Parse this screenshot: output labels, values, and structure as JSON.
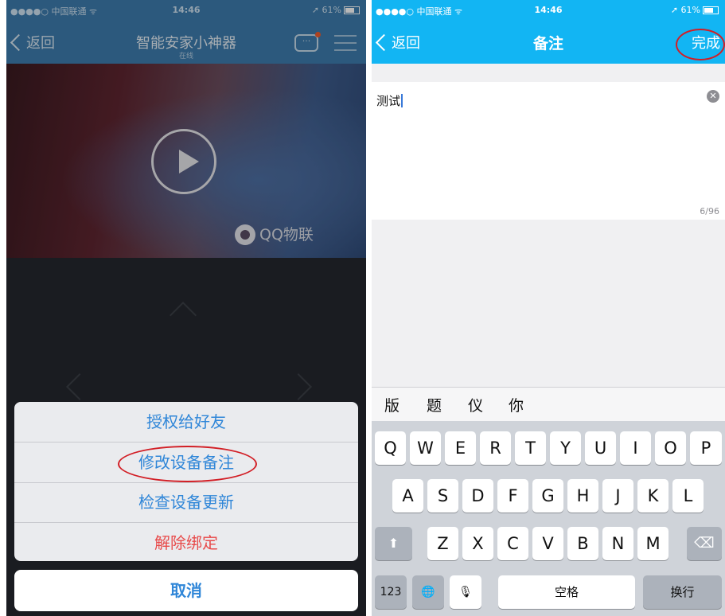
{
  "left_screen": {
    "status": {
      "carrier": "●●●●○ 中国联通 ᯤ",
      "time": "14:46",
      "battery": "➚ 61%"
    },
    "nav": {
      "back_label": "返回",
      "title": "智能安家小神器",
      "subtitle": "在线",
      "message_icon_glyph": "···"
    },
    "video": {
      "watermark": "QQ物联"
    },
    "action_sheet": {
      "items": [
        "授权给好友",
        "修改设备备注",
        "检查设备更新",
        "解除绑定"
      ],
      "cancel": "取消",
      "destructive_color": "#e84a4a",
      "accent_color": "#2f86d8"
    }
  },
  "right_screen": {
    "status": {
      "carrier": "●●●●○ 中国联通 ᯤ",
      "time": "14:46",
      "battery": "➚ 61%"
    },
    "nav": {
      "back_label": "返回",
      "title": "备注",
      "done_label": "完成",
      "bar_color": "#12b5f3"
    },
    "editor": {
      "text": "测试",
      "counter": "6/96",
      "clear_glyph": "✕"
    },
    "suggestions": [
      "版",
      "题",
      "仪",
      "你"
    ],
    "keyboard": {
      "row1": [
        "Q",
        "W",
        "E",
        "R",
        "T",
        "Y",
        "U",
        "I",
        "O",
        "P"
      ],
      "row2": [
        "A",
        "S",
        "D",
        "F",
        "G",
        "H",
        "J",
        "K",
        "L"
      ],
      "row3": [
        "Z",
        "X",
        "C",
        "V",
        "B",
        "N",
        "M"
      ],
      "shift_glyph": "⬆",
      "delete_glyph": "⌫",
      "numbers_label": "123",
      "globe_glyph": "🌐",
      "mic_glyph": "🎙",
      "space_label": "空格",
      "return_label": "换行"
    }
  }
}
